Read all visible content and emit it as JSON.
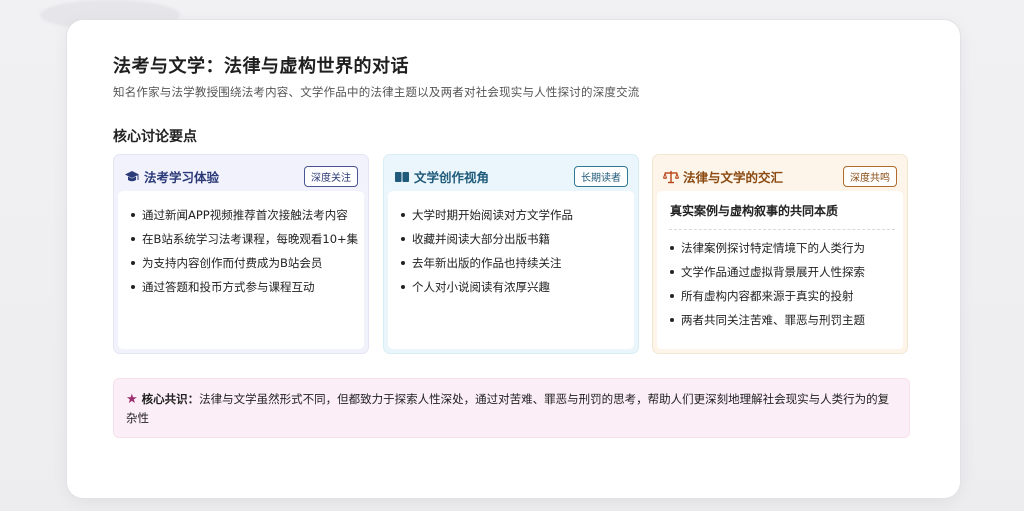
{
  "header": {
    "title": "法考与文学：法律与虚构世界的对话",
    "subtitle": "知名作家与法学教授围绕法考内容、文学作品中的法律主题以及两者对社会现实与人性探讨的深度交流"
  },
  "section": {
    "title": "核心讨论要点"
  },
  "columns": [
    {
      "icon": "graduation-cap-icon",
      "label": "法考学习体验",
      "tag": "深度关注",
      "items": [
        "通过新闻APP视频推荐首次接触法考内容",
        "在B站系统学习法考课程，每晚观看10+集",
        "为支持内容创作而付费成为B站会员",
        "通过答题和投币方式参与课程互动"
      ]
    },
    {
      "icon": "book-icon",
      "label": "文学创作视角",
      "tag": "长期读者",
      "items": [
        "大学时期开始阅读对方文学作品",
        "收藏并阅读大部分出版书籍",
        "去年新出版的作品也持续关注",
        "个人对小说阅读有浓厚兴趣"
      ]
    },
    {
      "icon": "scales-icon",
      "label": "法律与文学的交汇",
      "tag": "深度共鸣",
      "heading": "真实案例与虚构叙事的共同本质",
      "items": [
        "法律案例探讨特定情境下的人类行为",
        "文学作品通过虚拟背景展开人性探索",
        "所有虚构内容都来源于真实的投射",
        "两者共同关注苦难、罪恶与刑罚主题"
      ]
    }
  ],
  "consensus": {
    "icon": "star-icon",
    "label": "核心共识：",
    "text": "法律与文学虽然形式不同，但都致力于探索人性深处，通过对苦难、罪恶与刑罚的思考，帮助人们更深刻地理解社会现实与人类行为的复杂性"
  },
  "colors": {
    "col1_accent": "#2b3a78",
    "col2_accent": "#1f5a7a",
    "col3_accent": "#8a4a12",
    "star": "#9b2d6e"
  }
}
